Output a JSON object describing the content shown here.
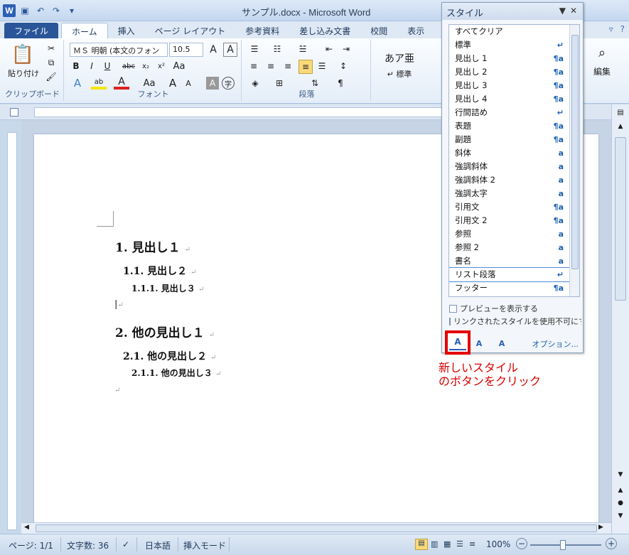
{
  "window": {
    "title": "サンプル.docx - Microsoft Word"
  },
  "tabs": [
    "ファイル",
    "ホーム",
    "挿入",
    "ページ レイアウト",
    "参考資料",
    "差し込み文書",
    "校閲",
    "表示"
  ],
  "ribbon": {
    "clipboard": {
      "paste": "貼り付け",
      "label": "クリップボード"
    },
    "font": {
      "name": "ＭＳ 明朝 (本文のフォン",
      "size": "10.5",
      "label": "フォント"
    },
    "paragraph": {
      "label": "段落"
    },
    "styles_gallery": {
      "preview": "あア亜",
      "name": "↵ 標準"
    },
    "editing": {
      "label": "編集"
    }
  },
  "document": {
    "lines": [
      "1. 見出し１",
      "1.1. 見出し２",
      "1.1.1. 見出し３",
      "2. 他の見出し１",
      "2.1. 他の見出し２",
      "2.1.1. 他の見出し３"
    ]
  },
  "styles_pane": {
    "title": "スタイル",
    "items": [
      {
        "name": "すべてクリア",
        "mark": ""
      },
      {
        "name": "標準",
        "mark": "↵"
      },
      {
        "name": "見出し 1",
        "mark": "¶a"
      },
      {
        "name": "見出し 2",
        "mark": "¶a"
      },
      {
        "name": "見出し 3",
        "mark": "¶a"
      },
      {
        "name": "見出し 4",
        "mark": "¶a"
      },
      {
        "name": "行間詰め",
        "mark": "↵"
      },
      {
        "name": "表題",
        "mark": "¶a"
      },
      {
        "name": "副題",
        "mark": "¶a"
      },
      {
        "name": "斜体",
        "mark": "a"
      },
      {
        "name": "強調斜体",
        "mark": "a"
      },
      {
        "name": "強調斜体 2",
        "mark": "a"
      },
      {
        "name": "強調太字",
        "mark": "a"
      },
      {
        "name": "引用文",
        "mark": "¶a"
      },
      {
        "name": "引用文 2",
        "mark": "¶a"
      },
      {
        "name": "参照",
        "mark": "a"
      },
      {
        "name": "参照 2",
        "mark": "a"
      },
      {
        "name": "書名",
        "mark": "a"
      },
      {
        "name": "リスト段落",
        "mark": "↵"
      },
      {
        "name": "フッター",
        "mark": "¶a"
      }
    ],
    "show_preview": "プレビューを表示する",
    "disable_linked": "リンクされたスタイルを使用不可にする",
    "options": "オプション..."
  },
  "annotation": {
    "line1": "新しいスタイル",
    "line2": "のボタンをクリック"
  },
  "statusbar": {
    "page": "ページ: 1/1",
    "words": "文字数: 36",
    "language": "日本語",
    "mode": "挿入モード",
    "zoom": "100%"
  }
}
